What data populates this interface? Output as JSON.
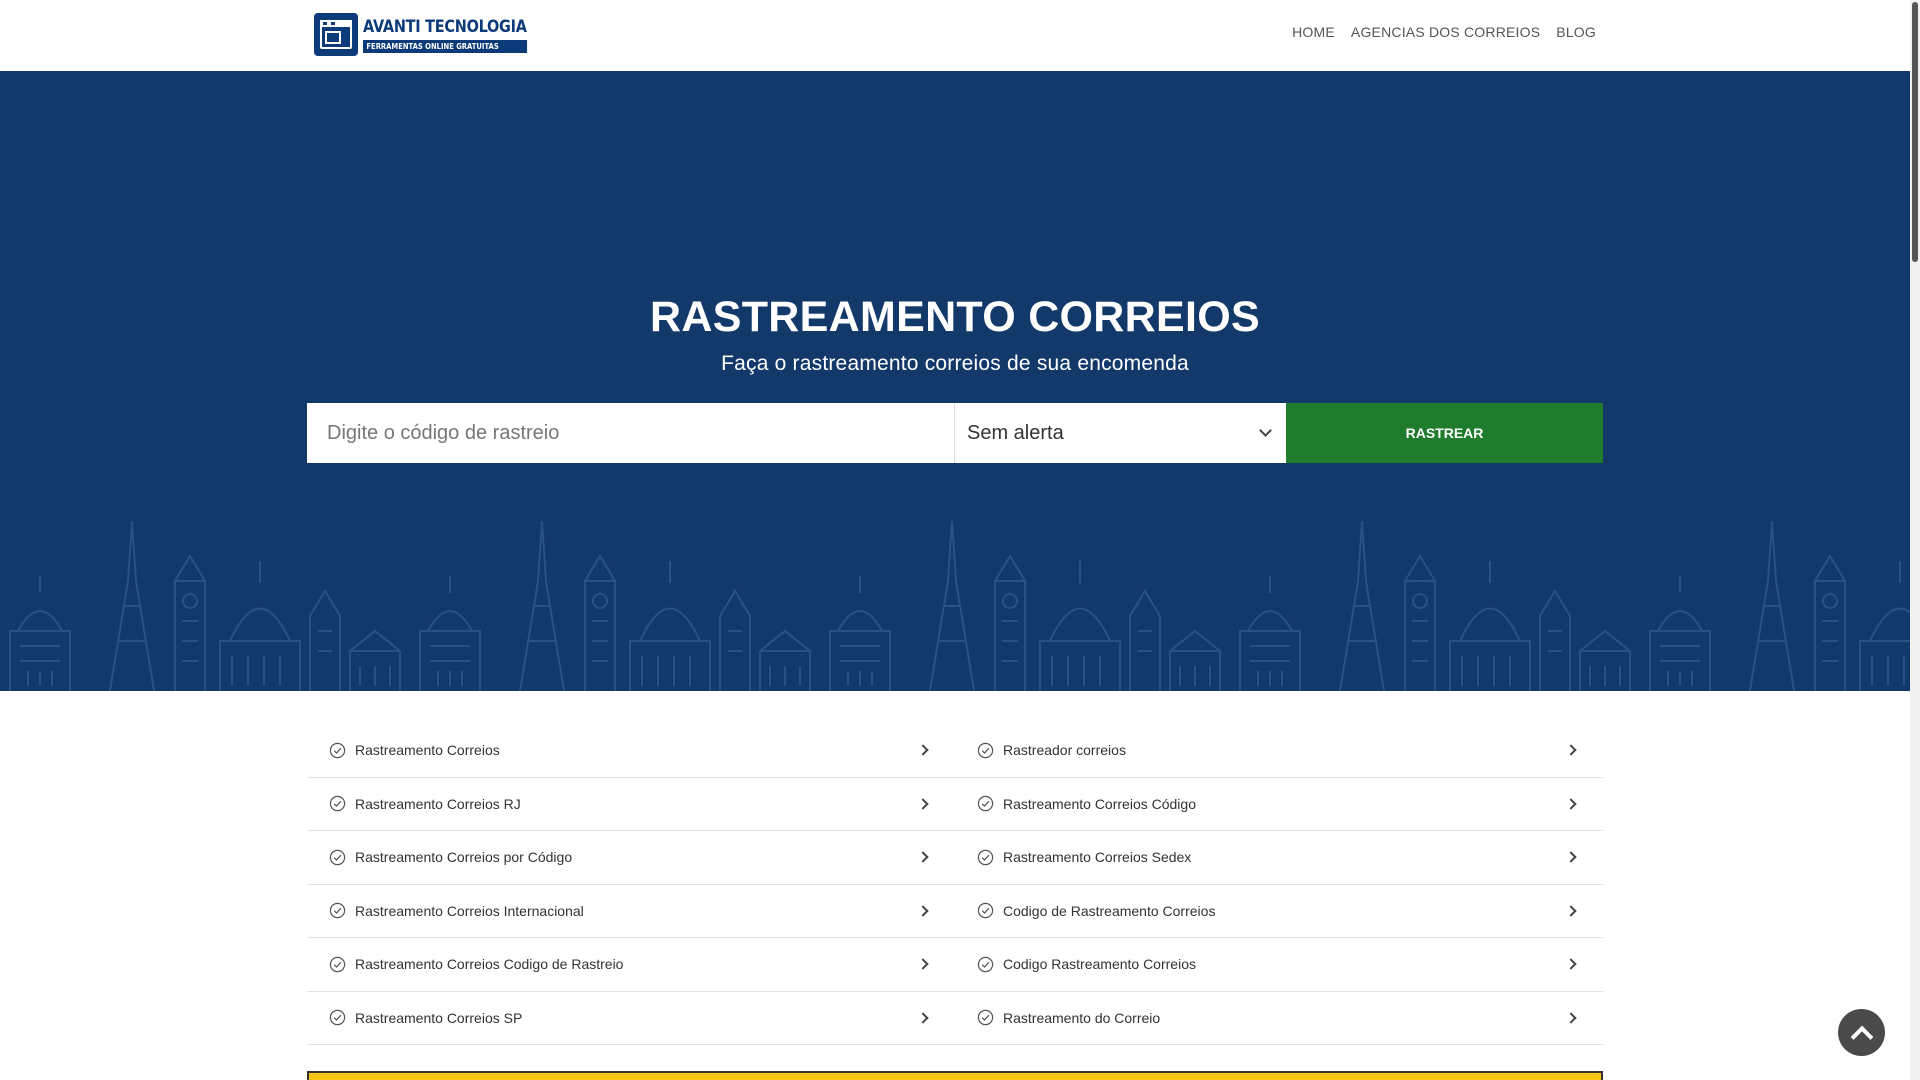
{
  "header": {
    "logo_title": "AVANTI TECNOLOGIA",
    "logo_subtitle": "FERRAMENTAS ONLINE GRATUITAS",
    "nav": [
      "HOME",
      "AGENCIAS DOS CORREIOS",
      "BLOG"
    ]
  },
  "hero": {
    "title": "RASTREAMENTO CORREIOS",
    "subtitle": "Faça o rastreamento correios de sua encomenda",
    "search_placeholder": "Digite o código de rastreio",
    "alert_value": "Sem alerta",
    "button_label": "RASTREAR",
    "background_color": "#13386a",
    "button_color": "#1e7c2c"
  },
  "links": [
    "Rastreamento Correios",
    "Rastreador correios",
    "Rastreamento Correios RJ",
    "Rastreamento Correios Código",
    "Rastreamento Correios por Código",
    "Rastreamento Correios Sedex",
    "Rastreamento Correios Internacional",
    "Codigo de Rastreamento Correios",
    "Rastreamento Correios Codigo de Rastreio",
    "Codigo Rastreamento Correios",
    "Rastreamento Correios SP",
    "Rastreamento do Correio"
  ],
  "icons": {
    "link_icon": "check-circle-icon",
    "link_arrow": "chevron-right-icon",
    "scroll_top": "chevron-up-icon"
  }
}
